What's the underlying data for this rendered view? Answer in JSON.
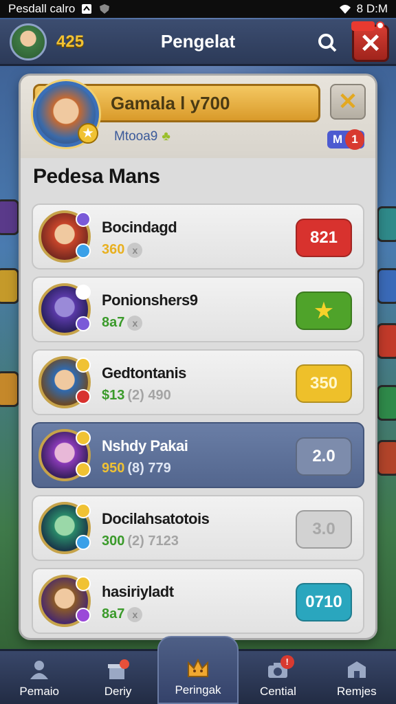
{
  "status_bar": {
    "left_text": "Pesdall calro",
    "right_text": "8 D:M"
  },
  "header": {
    "coins": "425",
    "title": "Pengelat",
    "close_label": "✕"
  },
  "profile": {
    "name": "Gamala l y700",
    "subtitle": "Mtooa9",
    "rank_letter": "M",
    "rank_number": "1",
    "close_label": "✕"
  },
  "section_title": "Pedesa Mans",
  "rows": [
    {
      "name": "Bocindagd",
      "score": "360",
      "extra": "",
      "pill": "821",
      "pill_color": "#d8322e",
      "highlight": false
    },
    {
      "name": "Ponionshers9",
      "score": "8a7",
      "extra": "",
      "pill": "★",
      "pill_color": "#4fa32a",
      "highlight": false
    },
    {
      "name": "Gedtontanis",
      "score": "$13",
      "extra": "(2) 490",
      "pill": "350",
      "pill_color": "#eec02a",
      "highlight": false
    },
    {
      "name": "Nshdy Pakai",
      "score": "950",
      "extra": "(8) 779",
      "pill": "2.0",
      "pill_color": "#7d8cac",
      "highlight": true
    },
    {
      "name": "Docilahsatotois",
      "score": "300",
      "extra": "(2) 7123",
      "pill": "3.0",
      "pill_color": "#d2d2d2",
      "highlight": false
    },
    {
      "name": "hasiriyladt",
      "score": "8a7",
      "extra": "",
      "pill": "0710",
      "pill_color": "#2aa6be",
      "highlight": false
    }
  ],
  "bottom_nav": [
    {
      "label": "Pemaio",
      "icon": "person-icon",
      "active": false
    },
    {
      "label": "Deriy",
      "icon": "gift-icon",
      "active": false
    },
    {
      "label": "Peringak",
      "icon": "crown-icon",
      "active": true
    },
    {
      "label": "Cential",
      "icon": "camera-icon",
      "active": false,
      "badge": "!"
    },
    {
      "label": "Remjes",
      "icon": "shop-icon",
      "active": false
    }
  ]
}
